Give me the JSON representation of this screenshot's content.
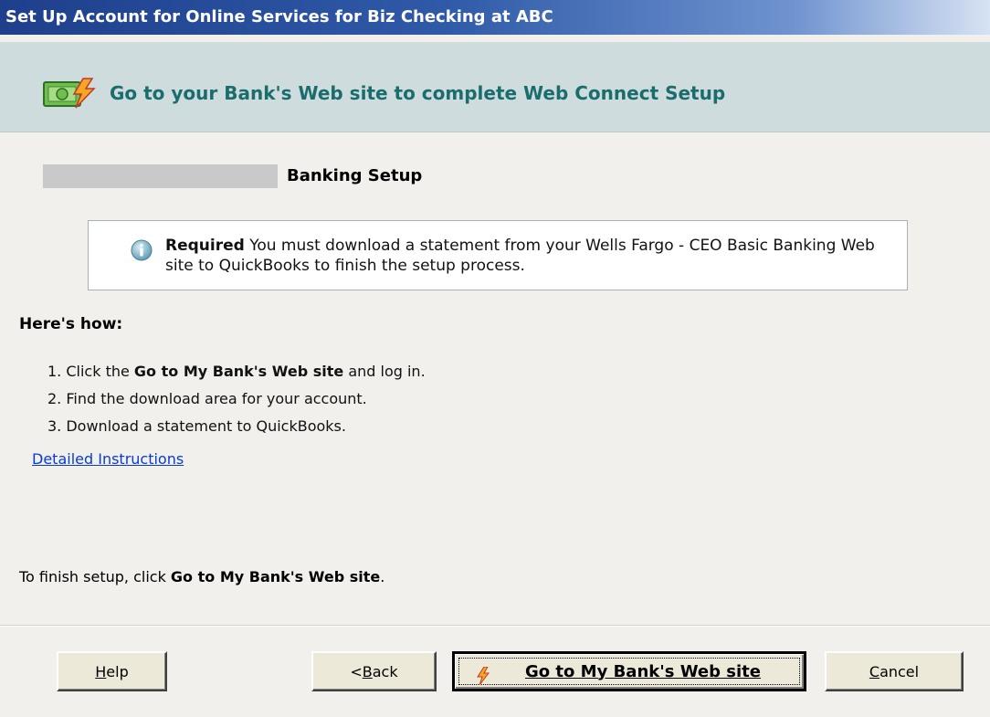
{
  "window": {
    "title": "Set Up Account for Online Services for Biz Checking at ABC"
  },
  "header": {
    "title": "Go to your Bank's Web site to complete Web Connect Setup",
    "icon": "money-bolt-icon"
  },
  "section": {
    "title": "Banking Setup"
  },
  "info_box": {
    "icon": "info-icon",
    "required_label": "Required",
    "message": " You must download a statement from your Wells Fargo - CEO Basic Banking Web site to QuickBooks to finish the setup process."
  },
  "instructions": {
    "heading": "Here's how:",
    "steps": [
      {
        "number": "1.",
        "prefix": "Click the ",
        "bold": "Go to My Bank's Web site",
        "suffix": " and log in."
      },
      {
        "number": "2.",
        "prefix": "Find the download area for your account.",
        "bold": "",
        "suffix": ""
      },
      {
        "number": "3.",
        "prefix": "Download a statement to QuickBooks.",
        "bold": "",
        "suffix": ""
      }
    ],
    "link": "Detailed Instructions"
  },
  "footer_text": {
    "prefix": "To finish setup, click ",
    "bold": "Go to My Bank's Web site",
    "suffix": "."
  },
  "buttons": {
    "help": {
      "mnemonic": "H",
      "rest": "elp"
    },
    "back": {
      "prefix": "< ",
      "mnemonic": "B",
      "rest": "ack"
    },
    "go": {
      "label": "Go to My Bank's Web site"
    },
    "cancel": {
      "mnemonic": "C",
      "rest": "ancel"
    }
  },
  "colors": {
    "title_bar_start": "#1e3f8c",
    "header_band": "#cfdcdd",
    "header_text": "#1b6d6d",
    "link": "#0a3ccf"
  }
}
